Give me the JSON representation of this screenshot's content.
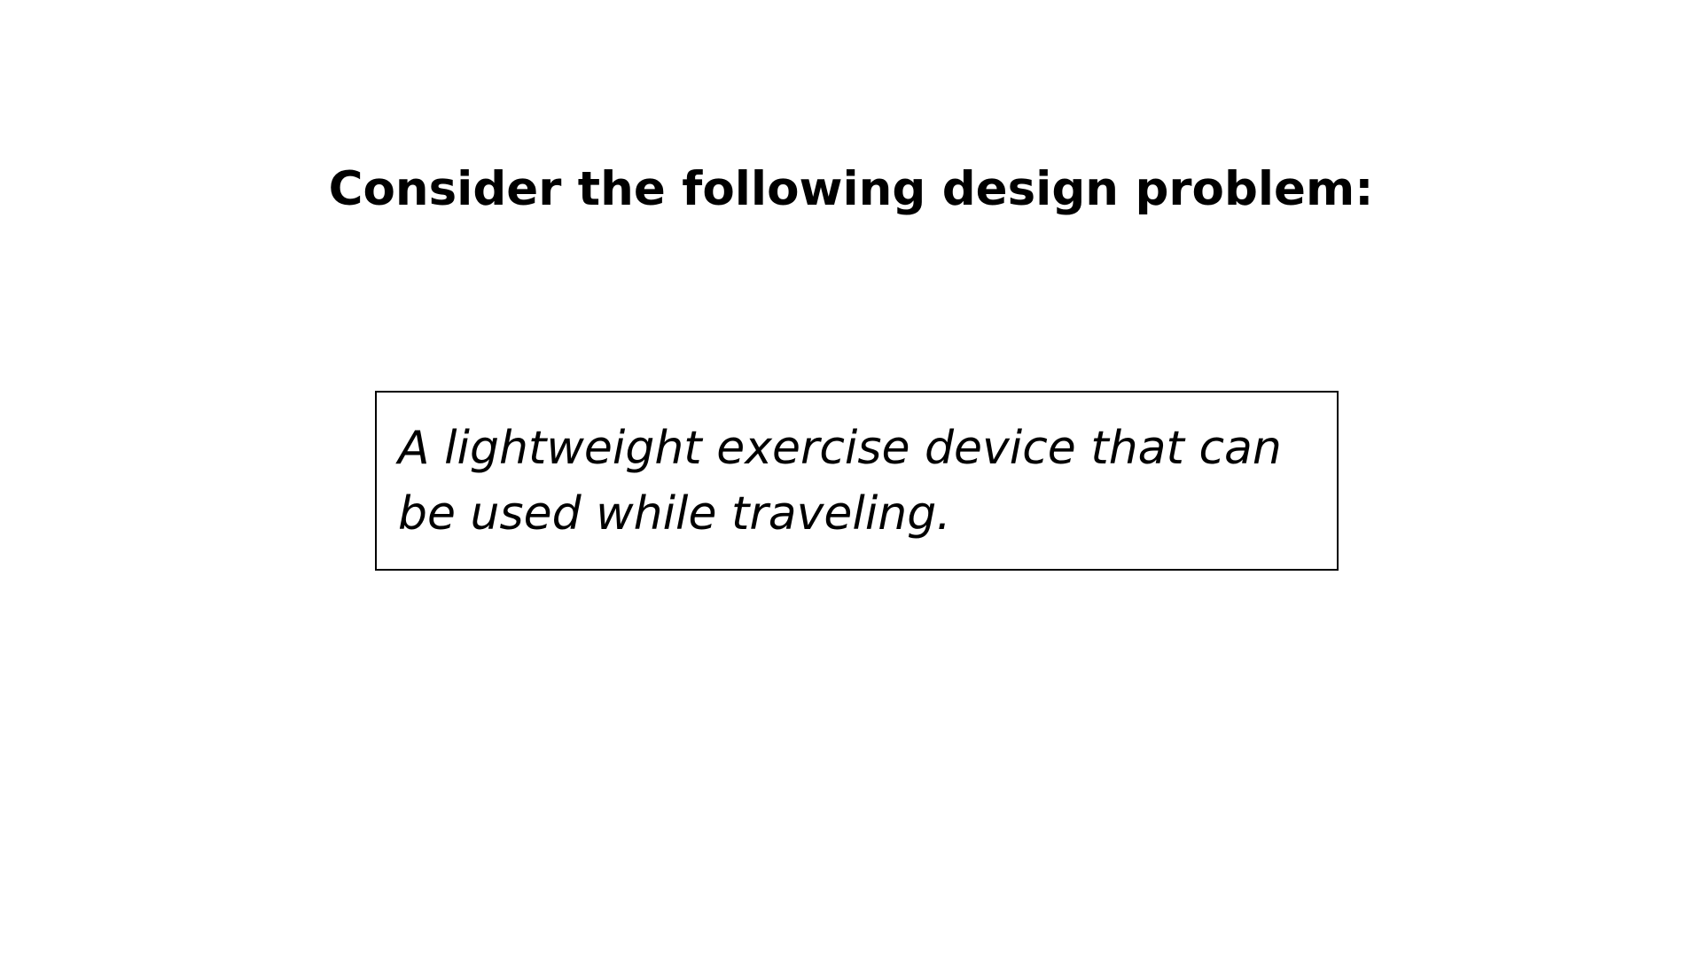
{
  "slide": {
    "heading": "Consider the following design problem:",
    "problem_text": "A lightweight exercise device that can be used while traveling."
  }
}
